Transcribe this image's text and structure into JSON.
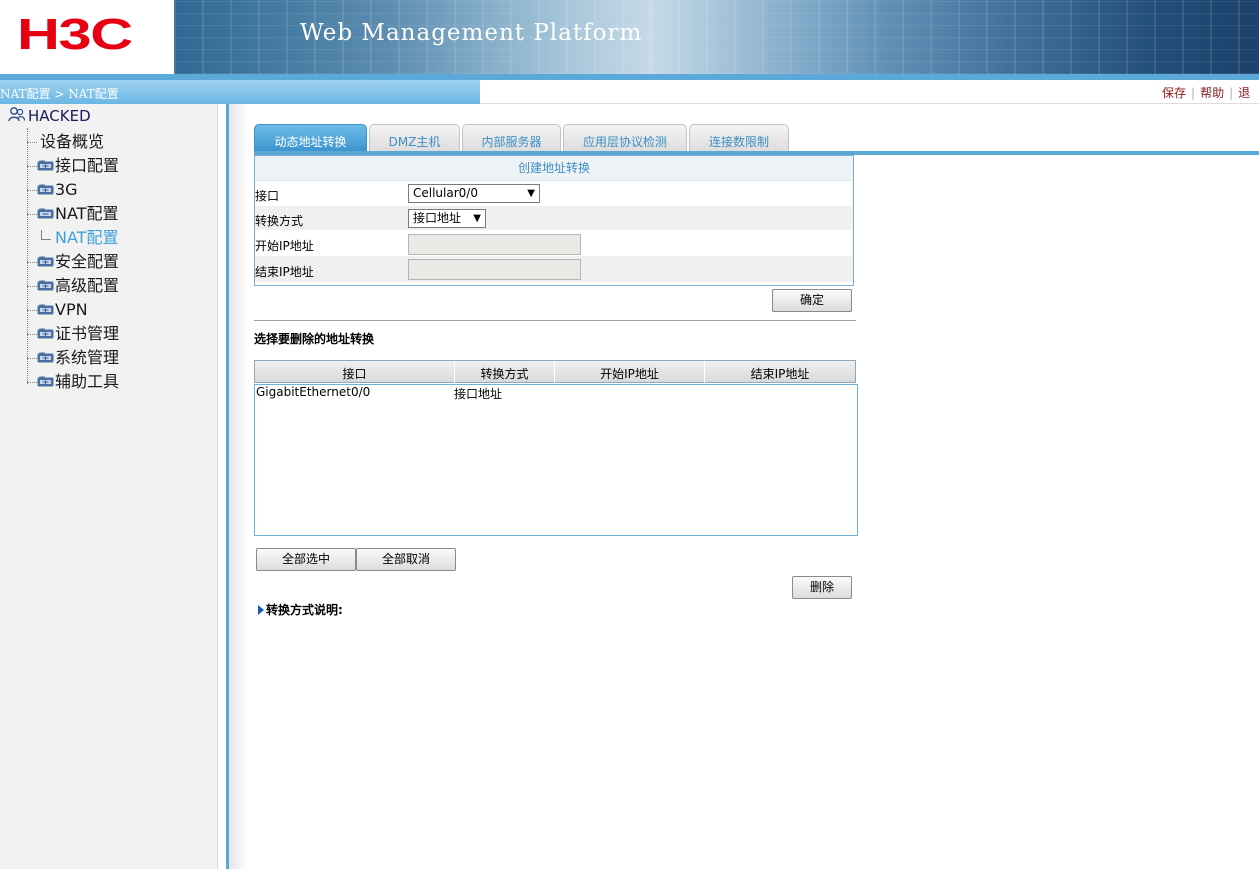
{
  "header": {
    "logo_text": "H3C",
    "title": "Web Management Platform",
    "brand_color": "#e60012"
  },
  "breadcrumb": "NAT配置 > NAT配置",
  "toplinks": {
    "save": "保存",
    "help": "帮助",
    "logout": "退"
  },
  "sidebar": {
    "root": "HACKED",
    "items": [
      {
        "label": "设备概览",
        "icon": "none"
      },
      {
        "label": "接口配置",
        "icon": "folder-icon"
      },
      {
        "label": "3G",
        "icon": "folder-icon"
      },
      {
        "label": "NAT配置",
        "icon": "folder-open-icon"
      },
      {
        "label": "安全配置",
        "icon": "folder-icon"
      },
      {
        "label": "高级配置",
        "icon": "folder-icon"
      },
      {
        "label": "VPN",
        "icon": "folder-icon"
      },
      {
        "label": "证书管理",
        "icon": "folder-icon"
      },
      {
        "label": "系统管理",
        "icon": "folder-icon"
      },
      {
        "label": "辅助工具",
        "icon": "folder-icon"
      }
    ],
    "subitem": "NAT配置"
  },
  "tabs": [
    {
      "label": "动态地址转换",
      "active": true
    },
    {
      "label": "DMZ主机",
      "active": false
    },
    {
      "label": "内部服务器",
      "active": false
    },
    {
      "label": "应用层协议检测",
      "active": false
    },
    {
      "label": "连接数限制",
      "active": false
    }
  ],
  "create": {
    "title": "创建地址转换",
    "interface_label": "接口",
    "interface_value": "Cellular0/0",
    "mode_label": "转换方式",
    "mode_value": "接口地址",
    "start_ip_label": "开始IP地址",
    "start_ip_value": "",
    "end_ip_label": "结束IP地址",
    "end_ip_value": "",
    "confirm": "确定"
  },
  "delete_section": {
    "title": "选择要删除的地址转换",
    "columns": [
      "接口",
      "转换方式",
      "开始IP地址",
      "结束IP地址"
    ],
    "rows": [
      {
        "interface": "GigabitEthernet0/0",
        "mode": "接口地址",
        "start_ip": "",
        "end_ip": ""
      }
    ],
    "select_all": "全部选中",
    "deselect_all": "全部取消",
    "delete": "删除"
  },
  "note": "转换方式说明:",
  "colors": {
    "accent": "#5ba9d8",
    "tab_active": "#3b94cf",
    "link": "#8b1a1a",
    "tree_selected": "#3da1d8"
  }
}
